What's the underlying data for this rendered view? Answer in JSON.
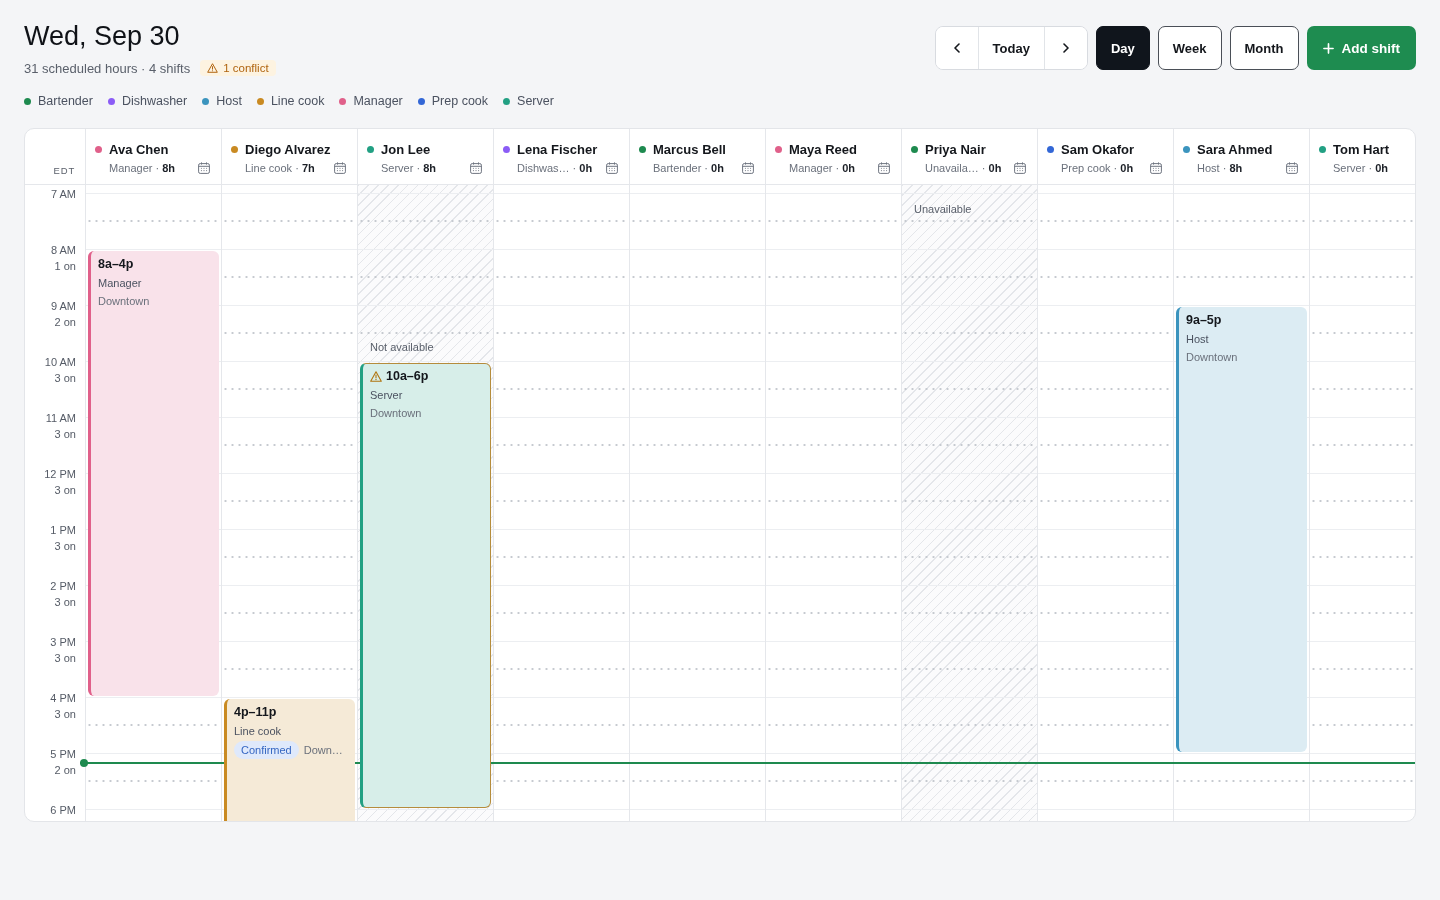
{
  "header": {
    "title": "Wed, Sep 30",
    "summary": "31 scheduled hours · 4 shifts",
    "conflict_badge": "1 conflict"
  },
  "legend": [
    {
      "label": "Bartender",
      "color": "#1e8a4f"
    },
    {
      "label": "Dishwasher",
      "color": "#8b5cf6"
    },
    {
      "label": "Host",
      "color": "#3b94be"
    },
    {
      "label": "Line cook",
      "color": "#c98a22"
    },
    {
      "label": "Manager",
      "color": "#e0608a"
    },
    {
      "label": "Prep cook",
      "color": "#3367d6"
    },
    {
      "label": "Server",
      "color": "#22a083"
    }
  ],
  "toolbar": {
    "today": "Today",
    "views": [
      {
        "label": "Day",
        "selected": true
      },
      {
        "label": "Week",
        "selected": false
      },
      {
        "label": "Month",
        "selected": false
      }
    ],
    "add_button": "Add shift"
  },
  "calendar": {
    "timezone": "EDT",
    "hours": [
      {
        "label": "7 AM",
        "current": false
      },
      {
        "label": "8 AM",
        "count": "1 on",
        "current": false
      },
      {
        "label": "9 AM",
        "count": "2 on",
        "current": false
      },
      {
        "label": "10 AM",
        "count": "3 on",
        "current": false
      },
      {
        "label": "11 AM",
        "count": "3 on",
        "current": false
      },
      {
        "label": "12 PM",
        "count": "3 on",
        "current": false
      },
      {
        "label": "1 PM",
        "count": "3 on",
        "current": false
      },
      {
        "label": "2 PM",
        "count": "3 on",
        "current": false
      },
      {
        "label": "3 PM",
        "count": "3 on",
        "current": false
      },
      {
        "label": "4 PM",
        "count": "3 on",
        "current": false
      },
      {
        "label": "5 PM",
        "count": "2 on",
        "current": true
      },
      {
        "label": "6 PM",
        "current": false
      }
    ],
    "columns": [
      {
        "name": "Ava Chen",
        "color": "#e0608a",
        "detail": "Manager · **8h**",
        "schedule_icon": true,
        "shifts": [
          {
            "time": "8a–4p",
            "role": "Manager",
            "location": "Downtown",
            "color": "#e0608a",
            "conflict": false
          }
        ]
      },
      {
        "name": "Diego Alvarez",
        "color": "#c98a22",
        "detail": "Line cook · **7h**",
        "schedule_icon": true,
        "shifts": [
          {
            "time": "4p–11p",
            "role": "Line cook",
            "status": "Confirmed",
            "location": "Down…",
            "color": "#c98a22",
            "conflict": false
          }
        ]
      },
      {
        "name": "Jon Lee",
        "color": "#22a083",
        "detail": "Server · **8h**",
        "schedule_icon": true,
        "availability_note": "Not available",
        "shifts": [
          {
            "time": "10a–6p",
            "role": "Server",
            "location": "Downtown",
            "color": "#22a083",
            "conflict": true
          }
        ]
      },
      {
        "name": "Lena Fischer",
        "color": "#8b5cf6",
        "detail": "Dishwas… · **0h**",
        "schedule_icon": true
      },
      {
        "name": "Marcus Bell",
        "color": "#1e8a4f",
        "detail": "Bartender · **0h**",
        "schedule_icon": true
      },
      {
        "name": "Maya Reed",
        "color": "#e0608a",
        "detail": "Manager · **0h**",
        "schedule_icon": true
      },
      {
        "name": "Priya Nair",
        "color": "#1e8a4f",
        "detail": "Unavaila… · **0h**",
        "schedule_icon": true,
        "availability_note": "Unavailable"
      },
      {
        "name": "Sam Okafor",
        "color": "#3367d6",
        "detail": "Prep cook · **0h**",
        "schedule_icon": true
      },
      {
        "name": "Sara Ahmed",
        "color": "#3b94be",
        "detail": "Host · **8h**",
        "schedule_icon": true,
        "shifts": [
          {
            "time": "9a–5p",
            "role": "Host",
            "location": "Downtown",
            "color": "#3b94be",
            "conflict": false
          }
        ]
      },
      {
        "name": "Tom Hart",
        "color": "#22a083",
        "detail": "Server · **0h**",
        "schedule_icon": false
      }
    ]
  }
}
